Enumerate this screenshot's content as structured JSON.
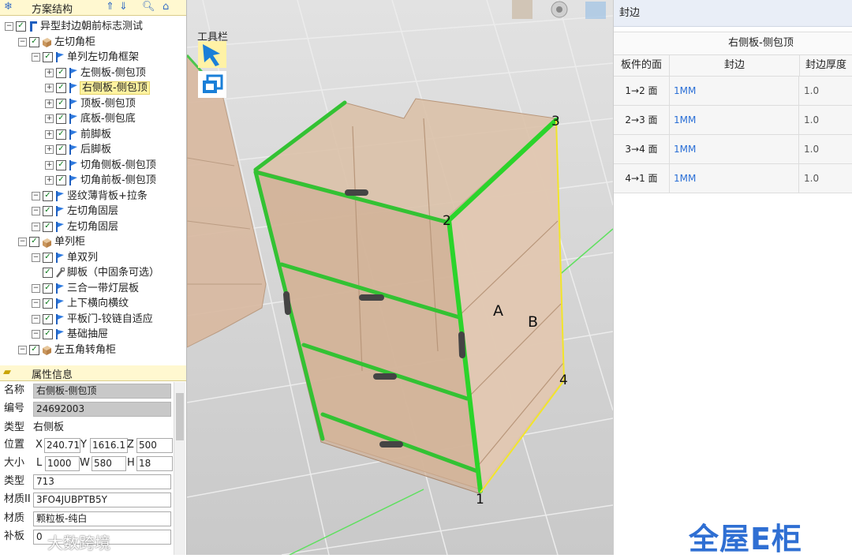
{
  "scheme_panel": {
    "title": "方案结构",
    "tree": [
      {
        "label": "异型封边朝前标志测试",
        "icon": "part-icon"
      },
      {
        "label": "左切角柜",
        "icon": "cabinet-icon"
      },
      {
        "label": "单列左切角框架",
        "icon": "flag-icon"
      },
      {
        "label": "左侧板-侧包顶",
        "icon": "flag-icon"
      },
      {
        "label": "右侧板-侧包顶",
        "icon": "flag-icon",
        "selected": true
      },
      {
        "label": "顶板-侧包顶",
        "icon": "flag-icon"
      },
      {
        "label": "底板-侧包底",
        "icon": "flag-icon"
      },
      {
        "label": "前脚板",
        "icon": "flag-icon"
      },
      {
        "label": "后脚板",
        "icon": "flag-icon"
      },
      {
        "label": "切角侧板-侧包顶",
        "icon": "flag-icon"
      },
      {
        "label": "切角前板-侧包顶",
        "icon": "flag-icon"
      },
      {
        "label": "竖纹薄背板+拉条",
        "icon": "flag-icon"
      },
      {
        "label": "左切角固层",
        "icon": "flag-icon"
      },
      {
        "label": "左切角固层",
        "icon": "flag-icon"
      },
      {
        "label": "单列柜",
        "icon": "cabinet-icon"
      },
      {
        "label": "单双列",
        "icon": "flag-icon"
      },
      {
        "label": "脚板（中固条可选）",
        "icon": "wrench-icon"
      },
      {
        "label": "三合一带灯层板",
        "icon": "flag-icon"
      },
      {
        "label": "上下横向横纹",
        "icon": "flag-icon"
      },
      {
        "label": "平板门-铰链自适应",
        "icon": "flag-icon"
      },
      {
        "label": "基础抽屉",
        "icon": "flag-icon"
      },
      {
        "label": "左五角转角柜",
        "icon": "cabinet-icon"
      }
    ]
  },
  "attr_panel": {
    "title": "属性信息",
    "name_label": "名称",
    "name_value": "右侧板-侧包顶",
    "code_label": "编号",
    "code_value": "24692003",
    "type_label": "类型",
    "type_value": "右侧板",
    "pos_label": "位置",
    "x_label": "X",
    "x_value": "240.71",
    "y_label": "Y",
    "y_value": "1616.1",
    "z_label": "Z",
    "z_value": "500",
    "size_label": "大小",
    "l_label": "L",
    "l_value": "1000",
    "w_label": "W",
    "w_value": "580",
    "h_label": "H",
    "h_value": "18",
    "type2_label": "类型",
    "type2_value": "713",
    "matid_label": "材质II",
    "matid_value": "3FO4JUBPTB5Y",
    "mat_label": "材质",
    "mat_value": "颗粒板-纯白",
    "last_label": "补板",
    "last_value": "0"
  },
  "toolbar": {
    "label": "工具栏"
  },
  "viewport": {
    "corner_labels": [
      "1",
      "2",
      "3",
      "4"
    ],
    "face_labels": [
      "A",
      "B"
    ]
  },
  "edge_panel": {
    "title": "封边",
    "board": "右侧板-侧包顶",
    "columns": [
      "板件的面",
      "封边",
      "封边厚度"
    ],
    "rows": [
      {
        "face": "1→2 面",
        "edge": "1MM",
        "thickness": "1.0"
      },
      {
        "face": "2→3 面",
        "edge": "1MM",
        "thickness": "1.0"
      },
      {
        "face": "3→4 面",
        "edge": "1MM",
        "thickness": "1.0"
      },
      {
        "face": "4→1 面",
        "edge": "1MM",
        "thickness": "1.0"
      }
    ]
  },
  "branding": {
    "logo": "全屋E柜",
    "watermark": "大数跨境"
  },
  "colors": {
    "accent": "#2f6fd3",
    "selection": "#fff3a0",
    "edge_green": "#3cc43c"
  }
}
